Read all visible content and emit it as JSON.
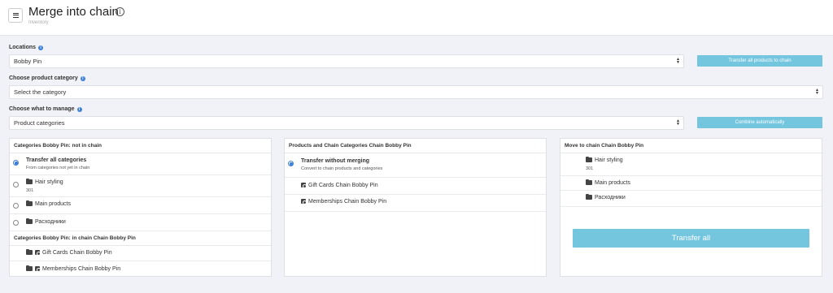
{
  "header": {
    "title": "Merge into chain",
    "subtitle": "Inventory"
  },
  "locations": {
    "label": "Locations",
    "value": "Bobby Pin",
    "button": "Transfer all products to chain"
  },
  "category": {
    "label": "Choose product category",
    "value": "Select the category"
  },
  "manage": {
    "label": "Choose what to manage",
    "value": "Product categories",
    "button": "Combine automatically"
  },
  "left_panel": {
    "title": "Categories Bobby Pin: not in chain",
    "items": [
      {
        "label": "Transfer all categories",
        "sub": "From categories not yet in chain"
      },
      {
        "label": "Hair styling",
        "sub": "301"
      },
      {
        "label": "Main products",
        "sub": ""
      },
      {
        "label": "Расходники",
        "sub": ""
      }
    ],
    "in_chain_title": "Categories Bobby Pin: in chain Chain Bobby Pin",
    "in_chain_items": [
      {
        "label": "Gift Cards Chain Bobby Pin"
      },
      {
        "label": "Memberships Chain Bobby Pin"
      }
    ]
  },
  "middle_panel": {
    "title": "Products and Chain Categories Chain Bobby Pin",
    "items": [
      {
        "label": "Transfer without merging",
        "sub": "Convert to chain products and categories"
      },
      {
        "label": "Gift Cards Chain Bobby Pin",
        "sub": ""
      },
      {
        "label": "Memberships Chain Bobby Pin",
        "sub": ""
      }
    ]
  },
  "right_panel": {
    "title": "Move to chain Chain Bobby Pin",
    "items": [
      {
        "label": "Hair styling",
        "sub": "301"
      },
      {
        "label": "Main products",
        "sub": ""
      },
      {
        "label": "Расходники",
        "sub": ""
      }
    ],
    "button": "Transfer all"
  },
  "icons": {
    "menu": "hamburger-icon",
    "info": "info-icon",
    "folder": "folder-icon",
    "gift": "gift-card-icon"
  },
  "colors": {
    "accent": "#74c6de",
    "radio": "#3d7fd6",
    "background": "#f0f2f7"
  }
}
